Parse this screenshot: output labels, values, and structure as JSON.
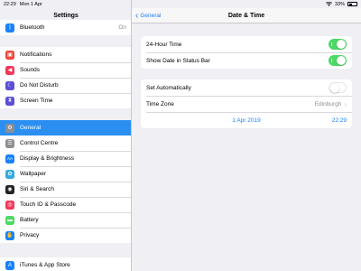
{
  "status_bar": {
    "time": "22:29",
    "date": "Mon 1 Apr",
    "battery": "33%"
  },
  "sidebar": {
    "title": "Settings",
    "groups": [
      [
        {
          "label": "Bluetooth",
          "value": "On",
          "icon": "bluetooth-icon",
          "color": "#1a82fb",
          "glyph": "ᛒ"
        }
      ],
      [
        {
          "label": "Notifications",
          "icon": "notifications-icon",
          "color": "#f0463c",
          "glyph": "▣"
        },
        {
          "label": "Sounds",
          "icon": "sounds-icon",
          "color": "#f0395a",
          "glyph": "◀"
        },
        {
          "label": "Do Not Disturb",
          "icon": "moon-icon",
          "color": "#5b4fd6",
          "glyph": "☾"
        },
        {
          "label": "Screen Time",
          "icon": "hourglass-icon",
          "color": "#5b4fd6",
          "glyph": "⧗"
        }
      ],
      [
        {
          "label": "General",
          "icon": "gear-icon",
          "color": "#8e8e93",
          "glyph": "⚙",
          "selected": true
        },
        {
          "label": "Control Centre",
          "icon": "control-centre-icon",
          "color": "#8e8e93",
          "glyph": "☰"
        },
        {
          "label": "Display & Brightness",
          "icon": "display-icon",
          "color": "#1a82fb",
          "glyph": "AA"
        },
        {
          "label": "Wallpaper",
          "icon": "wallpaper-icon",
          "color": "#35aadc",
          "glyph": "✿"
        },
        {
          "label": "Siri & Search",
          "icon": "siri-icon",
          "color": "#222",
          "glyph": "◉"
        },
        {
          "label": "Touch ID & Passcode",
          "icon": "fingerprint-icon",
          "color": "#f0395a",
          "glyph": "◎"
        },
        {
          "label": "Battery",
          "icon": "battery-icon",
          "color": "#4cd964",
          "glyph": "▬"
        },
        {
          "label": "Privacy",
          "icon": "hand-icon",
          "color": "#1a82fb",
          "glyph": "✋"
        }
      ],
      [
        {
          "label": "iTunes & App Store",
          "icon": "app-store-icon",
          "color": "#1a82fb",
          "glyph": "A"
        }
      ]
    ]
  },
  "main": {
    "back_label": "General",
    "title": "Date & Time",
    "group1": [
      {
        "label": "24-Hour Time",
        "toggle": "on"
      },
      {
        "label": "Show Date in Status Bar",
        "toggle": "on"
      }
    ],
    "group2": {
      "set_automatically": {
        "label": "Set Automatically",
        "toggle": "off"
      },
      "time_zone": {
        "label": "Time Zone",
        "value": "Edinburgh"
      },
      "picker": {
        "date": "1 Apr 2019",
        "time": "22:29"
      }
    }
  }
}
